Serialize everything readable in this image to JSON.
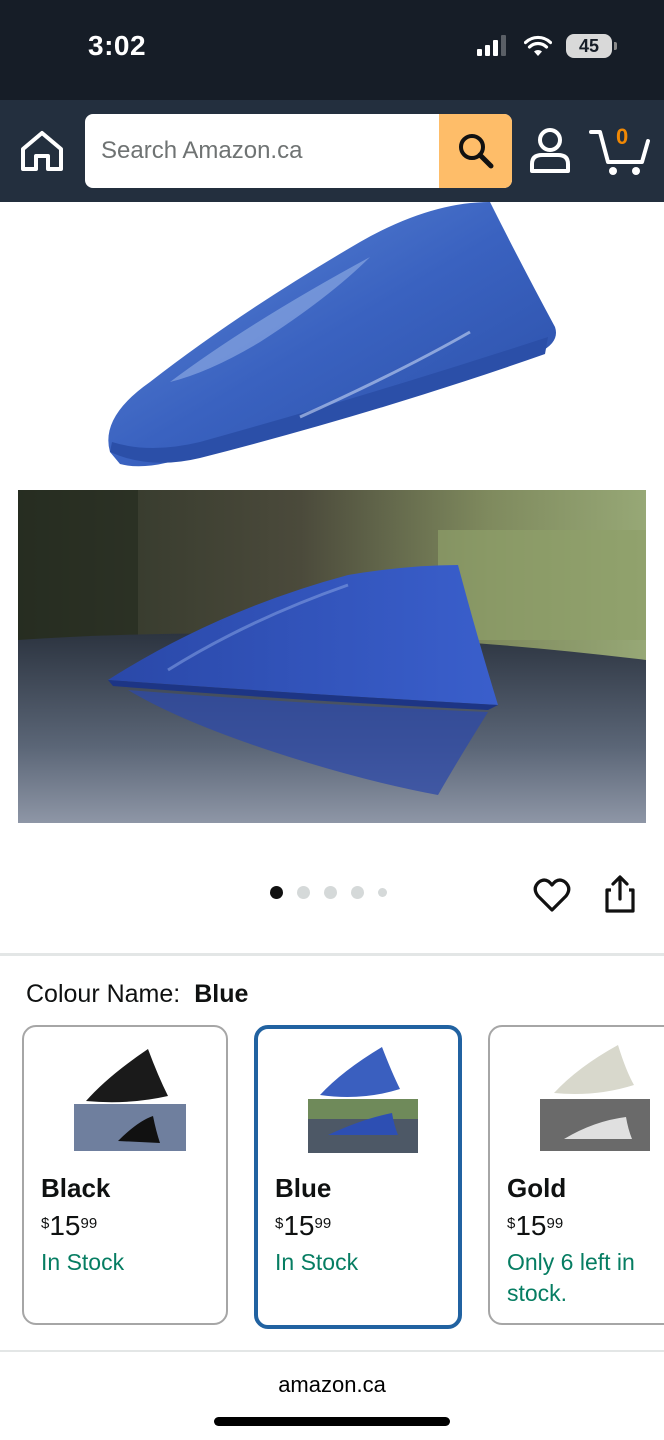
{
  "status_bar": {
    "time": "3:02",
    "battery": "45",
    "icons": [
      "signal-icon",
      "wifi-icon",
      "battery-icon"
    ]
  },
  "header": {
    "search_placeholder": "Search Amazon.ca",
    "cart_count": "0",
    "icons": [
      "home-icon",
      "search-icon",
      "account-icon",
      "cart-icon"
    ]
  },
  "gallery": {
    "pages": 5,
    "active_page": 1
  },
  "colour": {
    "label": "Colour Name:",
    "value": "Blue"
  },
  "swatches": [
    {
      "name": "Black",
      "currency": "$",
      "whole": "15",
      "cents": "99",
      "stock": "In Stock",
      "color": "#1a1a1a"
    },
    {
      "name": "Blue",
      "currency": "$",
      "whole": "15",
      "cents": "99",
      "stock": "In Stock",
      "color": "#3a5fbf"
    },
    {
      "name": "Gold",
      "currency": "$",
      "whole": "15",
      "cents": "99",
      "stock": "Only 6 left in stock.",
      "color": "#d8d8cc"
    }
  ],
  "footer": {
    "url": "amazon.ca"
  },
  "colors": {
    "header_bg": "#232f3e",
    "status_bg": "#161d27",
    "search_button": "#febd69",
    "cart_count": "#f08804",
    "stock_green": "#067d62",
    "selected_border": "#2162a1"
  }
}
